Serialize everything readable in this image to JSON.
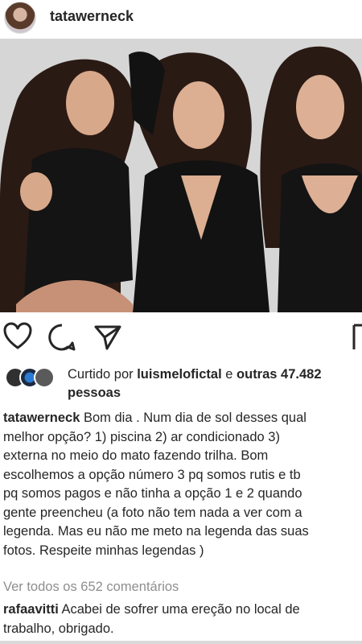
{
  "post": {
    "username": "tatawerneck",
    "avatar_icon": "profile-photo",
    "photo_description_icon": "post-photo"
  },
  "actions": {
    "like_icon": "heart-icon",
    "comment_icon": "comment-icon",
    "share_icon": "paper-plane-icon",
    "save_icon": "bookmark-icon"
  },
  "likes": {
    "prefix": "Curtido por ",
    "user": "luismelofictal",
    "middle": " e ",
    "others": "outras 47.482",
    "suffix": "pessoas"
  },
  "caption": {
    "username": "tatawerneck",
    "lines": [
      " Bom dia . Num dia de sol desses qual",
      "melhor opção? 1) piscina 2) ar condicionado 3)",
      "externa no meio do mato fazendo trilha. Bom",
      "escolhemos a opção número 3 pq somos rutis e tb",
      "pq somos pagos e não tinha a opção 1 e 2 quando",
      "gente preencheu (a foto não tem nada a ver com a",
      "legenda. Mas eu não me meto na legenda das suas",
      "fotos. Respeite minhas legendas )"
    ]
  },
  "comments": {
    "view_all": "Ver todos os 652 comentários",
    "first": {
      "username": "rafaavitti",
      "lines": [
        " Acabei de sofrer uma ereção no local de",
        "trabalho, obrigado."
      ]
    }
  },
  "colors": {
    "text": "#262626",
    "muted": "#8e8e8e",
    "background": "#ffffff"
  }
}
